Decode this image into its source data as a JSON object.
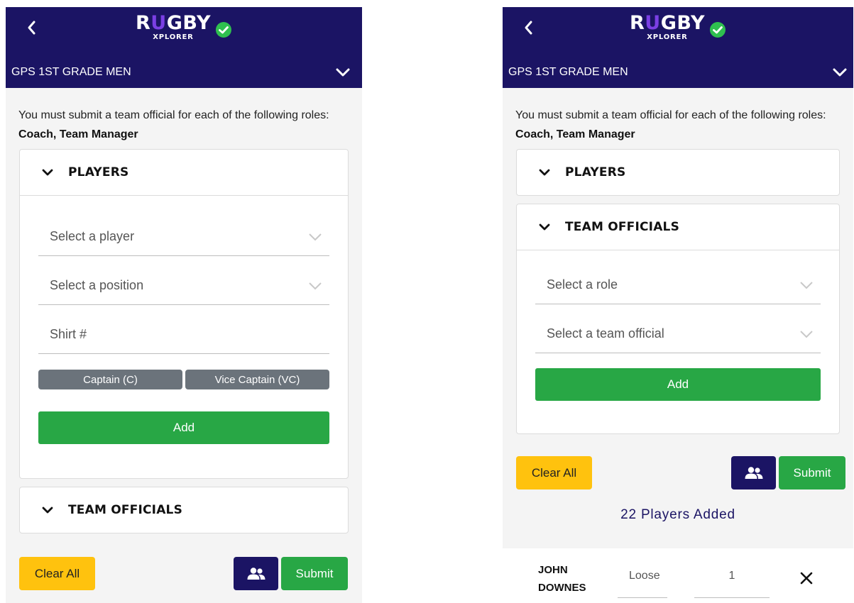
{
  "app": {
    "logo_rugby_pre": "R",
    "logo_rugby_u": "U",
    "logo_rugby_post": "GBY",
    "logo_xplorer": "XPLORER",
    "competition": "GPS 1ST GRADE MEN",
    "notice_prefix": "You must submit a team official for each of the following roles: ",
    "notice_roles": "Coach, Team Manager"
  },
  "left": {
    "players_section": {
      "title": "PLAYERS",
      "expanded": true,
      "player_placeholder": "Select a player",
      "position_placeholder": "Select a position",
      "shirt_placeholder": "Shirt #",
      "captain_label": "Captain (C)",
      "vice_captain_label": "Vice Captain (VC)",
      "add_label": "Add"
    },
    "officials_section": {
      "title": "TEAM OFFICIALS",
      "expanded": false
    }
  },
  "right": {
    "players_section": {
      "title": "PLAYERS",
      "expanded": false
    },
    "officials_section": {
      "title": "TEAM OFFICIALS",
      "expanded": true,
      "role_placeholder": "Select a role",
      "official_placeholder": "Select a team official",
      "add_label": "Add"
    },
    "players_added": "22 Players Added",
    "player_rows": [
      {
        "first_name": "JOHN",
        "last_name": "DOWNES",
        "position": "Loose",
        "shirt": "1"
      }
    ]
  },
  "actions": {
    "clear_label": "Clear All",
    "submit_label": "Submit"
  },
  "colors": {
    "navy": "#1b1464",
    "green": "#28a745",
    "yellow": "#ffc20e",
    "grey_toggle": "#6b737b",
    "logo_accent": "#7b3fe4",
    "verified_check": "#2fbf4f"
  },
  "icons": {
    "back": "chevron-left-icon",
    "verified": "check-circle-icon",
    "competition_toggle": "chevron-down-icon",
    "section_toggle": "chevron-down-icon",
    "dropdown": "chevron-down-icon",
    "team_list": "people-icon",
    "remove": "close-icon"
  }
}
